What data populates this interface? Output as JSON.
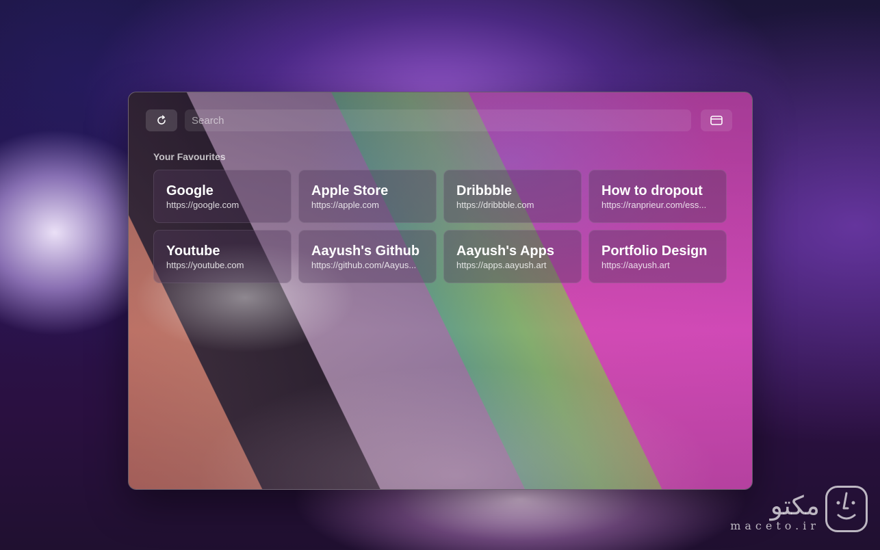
{
  "toolbar": {
    "reload_icon": "reload-icon",
    "window_icon": "window-icon"
  },
  "search": {
    "placeholder": "Search",
    "value": ""
  },
  "favourites": {
    "title": "Your Favourites",
    "items": [
      {
        "title": "Google",
        "url": "https://google.com"
      },
      {
        "title": "Apple Store",
        "url": "https://apple.com"
      },
      {
        "title": "Dribbble",
        "url": "https://dribbble.com"
      },
      {
        "title": "How to dropout",
        "url": "https://ranprieur.com/ess..."
      },
      {
        "title": "Youtube",
        "url": "https://youtube.com"
      },
      {
        "title": "Aayush's Github",
        "url": "https://github.com/Aayus..."
      },
      {
        "title": "Aayush's Apps",
        "url": "https://apps.aayush.art"
      },
      {
        "title": "Portfolio Design",
        "url": "https://aayush.art"
      }
    ]
  },
  "watermark": {
    "primary": "مکتو",
    "secondary": "maceto.ir"
  }
}
